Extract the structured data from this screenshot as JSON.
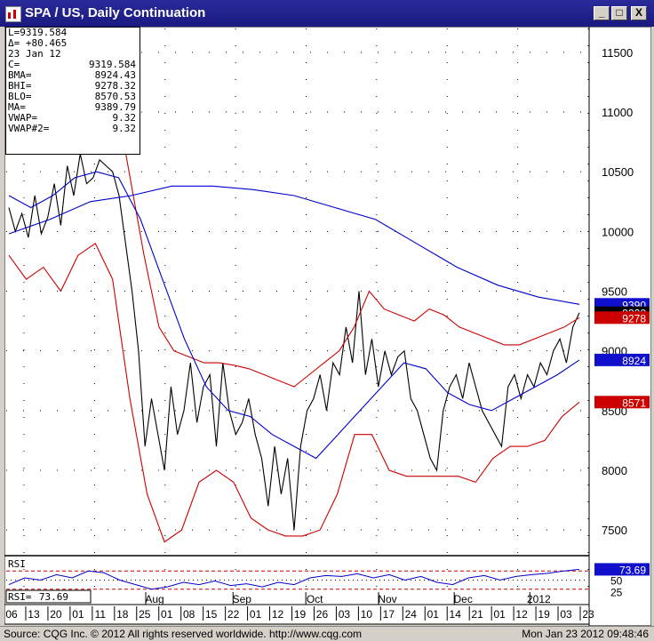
{
  "window": {
    "title": "SPA / US, Daily Continuation",
    "buttons": [
      "_",
      "□",
      "X"
    ]
  },
  "info_header": {
    "last": "L=9319.584",
    "delta": "Δ= +80.465"
  },
  "info_box": [
    {
      "k": "23 Jan 12",
      "v": ""
    },
    {
      "k": "C=",
      "v": "9319.584"
    },
    {
      "k": "BMA=",
      "v": "8924.43"
    },
    {
      "k": "BHI=",
      "v": "9278.32"
    },
    {
      "k": "BLO=",
      "v": "8570.53"
    },
    {
      "k": "MA=",
      "v": "9389.79"
    },
    {
      "k": "VWAP=",
      "v": "9.32"
    },
    {
      "k": "VWAP#2=",
      "v": "9.32"
    }
  ],
  "status": {
    "left": "Source: CQG Inc. © 2012 All rights reserved worldwide. http://www.cqg.com",
    "right": "Mon Jan 23 2012 09:48:46"
  },
  "colors": {
    "price": "#000000",
    "bollinger_band": "#cc0000",
    "moving_average": "#0000cc",
    "rsi": "#0000cc"
  },
  "chart_data": {
    "type": "line",
    "title": "SPA / US, Daily Continuation",
    "ylim": [
      7300,
      11700
    ],
    "yticks": [
      "11500",
      "11000",
      "10500",
      "10000",
      "9500",
      "9000",
      "8500",
      "8000",
      "7500"
    ],
    "yvalues": [
      11500,
      11000,
      10500,
      10000,
      9500,
      9000,
      8500,
      8000,
      7500
    ],
    "axis_tags": [
      {
        "label": "9390",
        "value": 9390,
        "bg": "#1010cc",
        "fg": "#ffffff"
      },
      {
        "label": "9320",
        "value": 9320,
        "bg": "#000000",
        "fg": "#ffffff"
      },
      {
        "label": "9278",
        "value": 9278,
        "bg": "#cc0000",
        "fg": "#ffffff"
      },
      {
        "label": "8924",
        "value": 8924,
        "bg": "#1010cc",
        "fg": "#ffffff"
      },
      {
        "label": "8571",
        "value": 8571,
        "bg": "#cc0000",
        "fg": "#ffffff"
      }
    ],
    "x_months": [
      "Aug",
      "Sep",
      "Oct",
      "Nov",
      "Dec",
      "2012"
    ],
    "x_days": [
      "06",
      "13",
      "20",
      "01",
      "11",
      "18",
      "25",
      "01",
      "08",
      "15",
      "22",
      "01",
      "12",
      "19",
      "26",
      "03",
      "10",
      "17",
      "24",
      "01",
      "14",
      "21",
      "01",
      "12",
      "19",
      "03",
      "23"
    ],
    "series": [
      {
        "name": "C",
        "color": "#000000",
        "values": [
          10200,
          10000,
          10150,
          9950,
          10300,
          9980,
          10120,
          10400,
          10050,
          10550,
          10300,
          10650,
          10400,
          10450,
          10600,
          10550,
          10500,
          10300,
          9900,
          9500,
          9000,
          8200,
          8600,
          8300,
          8000,
          8700,
          8300,
          8500,
          8900,
          8400,
          8700,
          8800,
          8200,
          8900,
          8500,
          8300,
          8400,
          8600,
          8300,
          8100,
          7700,
          8200,
          7800,
          8100,
          7500,
          8200,
          8500,
          8600,
          8800,
          8500,
          8900,
          8800,
          9200,
          8900,
          9500,
          8800,
          9100,
          8700,
          9000,
          8800,
          8950,
          9000,
          8600,
          8500,
          8300,
          8100,
          8000,
          8500,
          8700,
          8800,
          8600,
          8900,
          8700,
          8500,
          8400,
          8300,
          8200,
          8700,
          8800,
          8600,
          8800,
          8700,
          8900,
          8800,
          9000,
          9100,
          8900,
          9200,
          9320
        ]
      },
      {
        "name": "BHI",
        "color": "#cc0000",
        "values": [
          10900,
          10950,
          11000,
          11100,
          11300,
          11500,
          11500,
          11200,
          10500,
          9800,
          9200,
          9000,
          8950,
          8900,
          8900,
          8880,
          8850,
          8800,
          8750,
          8700,
          8800,
          8900,
          9000,
          9200,
          9500,
          9350,
          9300,
          9250,
          9350,
          9300,
          9200,
          9150,
          9100,
          9050,
          9050,
          9100,
          9150,
          9200,
          9278
        ]
      },
      {
        "name": "BLO",
        "color": "#cc0000",
        "values": [
          9800,
          9600,
          9700,
          9500,
          9800,
          9900,
          9600,
          8600,
          7800,
          7400,
          7500,
          7900,
          8000,
          7900,
          7600,
          7500,
          7450,
          7450,
          7500,
          7800,
          8300,
          8300,
          8000,
          7950,
          7950,
          7950,
          7950,
          7900,
          8100,
          8200,
          8200,
          8250,
          8450,
          8571
        ]
      },
      {
        "name": "MA",
        "color": "#0000cc",
        "values": [
          9980,
          10100,
          10250,
          10300,
          10380,
          10380,
          10350,
          10300,
          10200,
          10100,
          9900,
          9700,
          9550,
          9450,
          9390
        ]
      },
      {
        "name": "BMA",
        "color": "#0000cc",
        "values": [
          10300,
          10200,
          10300,
          10450,
          10500,
          10450,
          10100,
          9600,
          9100,
          8700,
          8500,
          8450,
          8300,
          8200,
          8100,
          8300,
          8500,
          8700,
          8900,
          8850,
          8650,
          8550,
          8500,
          8600,
          8700,
          8800,
          8924
        ]
      }
    ],
    "rsi": {
      "label": "RSI",
      "value_label": "RSI=",
      "value": 73.69,
      "value_text": "73.69",
      "levels": [
        "50",
        "25"
      ],
      "values": [
        40,
        55,
        50,
        62,
        55,
        70,
        66,
        50,
        40,
        30,
        35,
        45,
        40,
        48,
        38,
        42,
        35,
        45,
        40,
        55,
        60,
        58,
        64,
        55,
        62,
        50,
        58,
        45,
        40,
        55,
        60,
        50,
        58,
        62,
        65,
        70,
        73.69
      ]
    }
  }
}
